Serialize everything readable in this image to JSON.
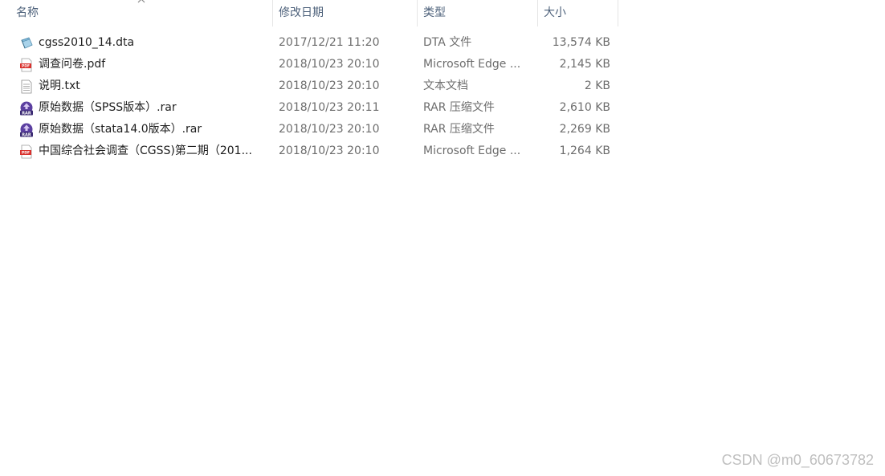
{
  "columns": {
    "name": "名称",
    "date": "修改日期",
    "type": "类型",
    "size": "大小"
  },
  "files": [
    {
      "name": "cgss2010_14.dta",
      "date": "2017/12/21 11:20",
      "type": "DTA 文件",
      "size": "13,574 KB",
      "icon": "dta-file-icon"
    },
    {
      "name": "调查问卷.pdf",
      "date": "2018/10/23 20:10",
      "type": "Microsoft Edge ...",
      "size": "2,145 KB",
      "icon": "pdf-file-icon"
    },
    {
      "name": "说明.txt",
      "date": "2018/10/23 20:10",
      "type": "文本文档",
      "size": "2 KB",
      "icon": "txt-file-icon"
    },
    {
      "name": "原始数据（SPSS版本）.rar",
      "date": "2018/10/23 20:11",
      "type": "RAR 压缩文件",
      "size": "2,610 KB",
      "icon": "rar-file-icon"
    },
    {
      "name": "原始数据（stata14.0版本）.rar",
      "date": "2018/10/23 20:10",
      "type": "RAR 压缩文件",
      "size": "2,269 KB",
      "icon": "rar-file-icon"
    },
    {
      "name": "中国综合社会调查（CGSS)第二期（201...",
      "date": "2018/10/23 20:10",
      "type": "Microsoft Edge ...",
      "size": "1,264 KB",
      "icon": "pdf-file-icon"
    }
  ],
  "watermark": "CSDN @m0_60673782",
  "colors": {
    "header_text": "#4c607a",
    "detail_text": "#6d6d6d",
    "pdf_red": "#d9322e",
    "rar_purple": "#5b3fa0"
  }
}
